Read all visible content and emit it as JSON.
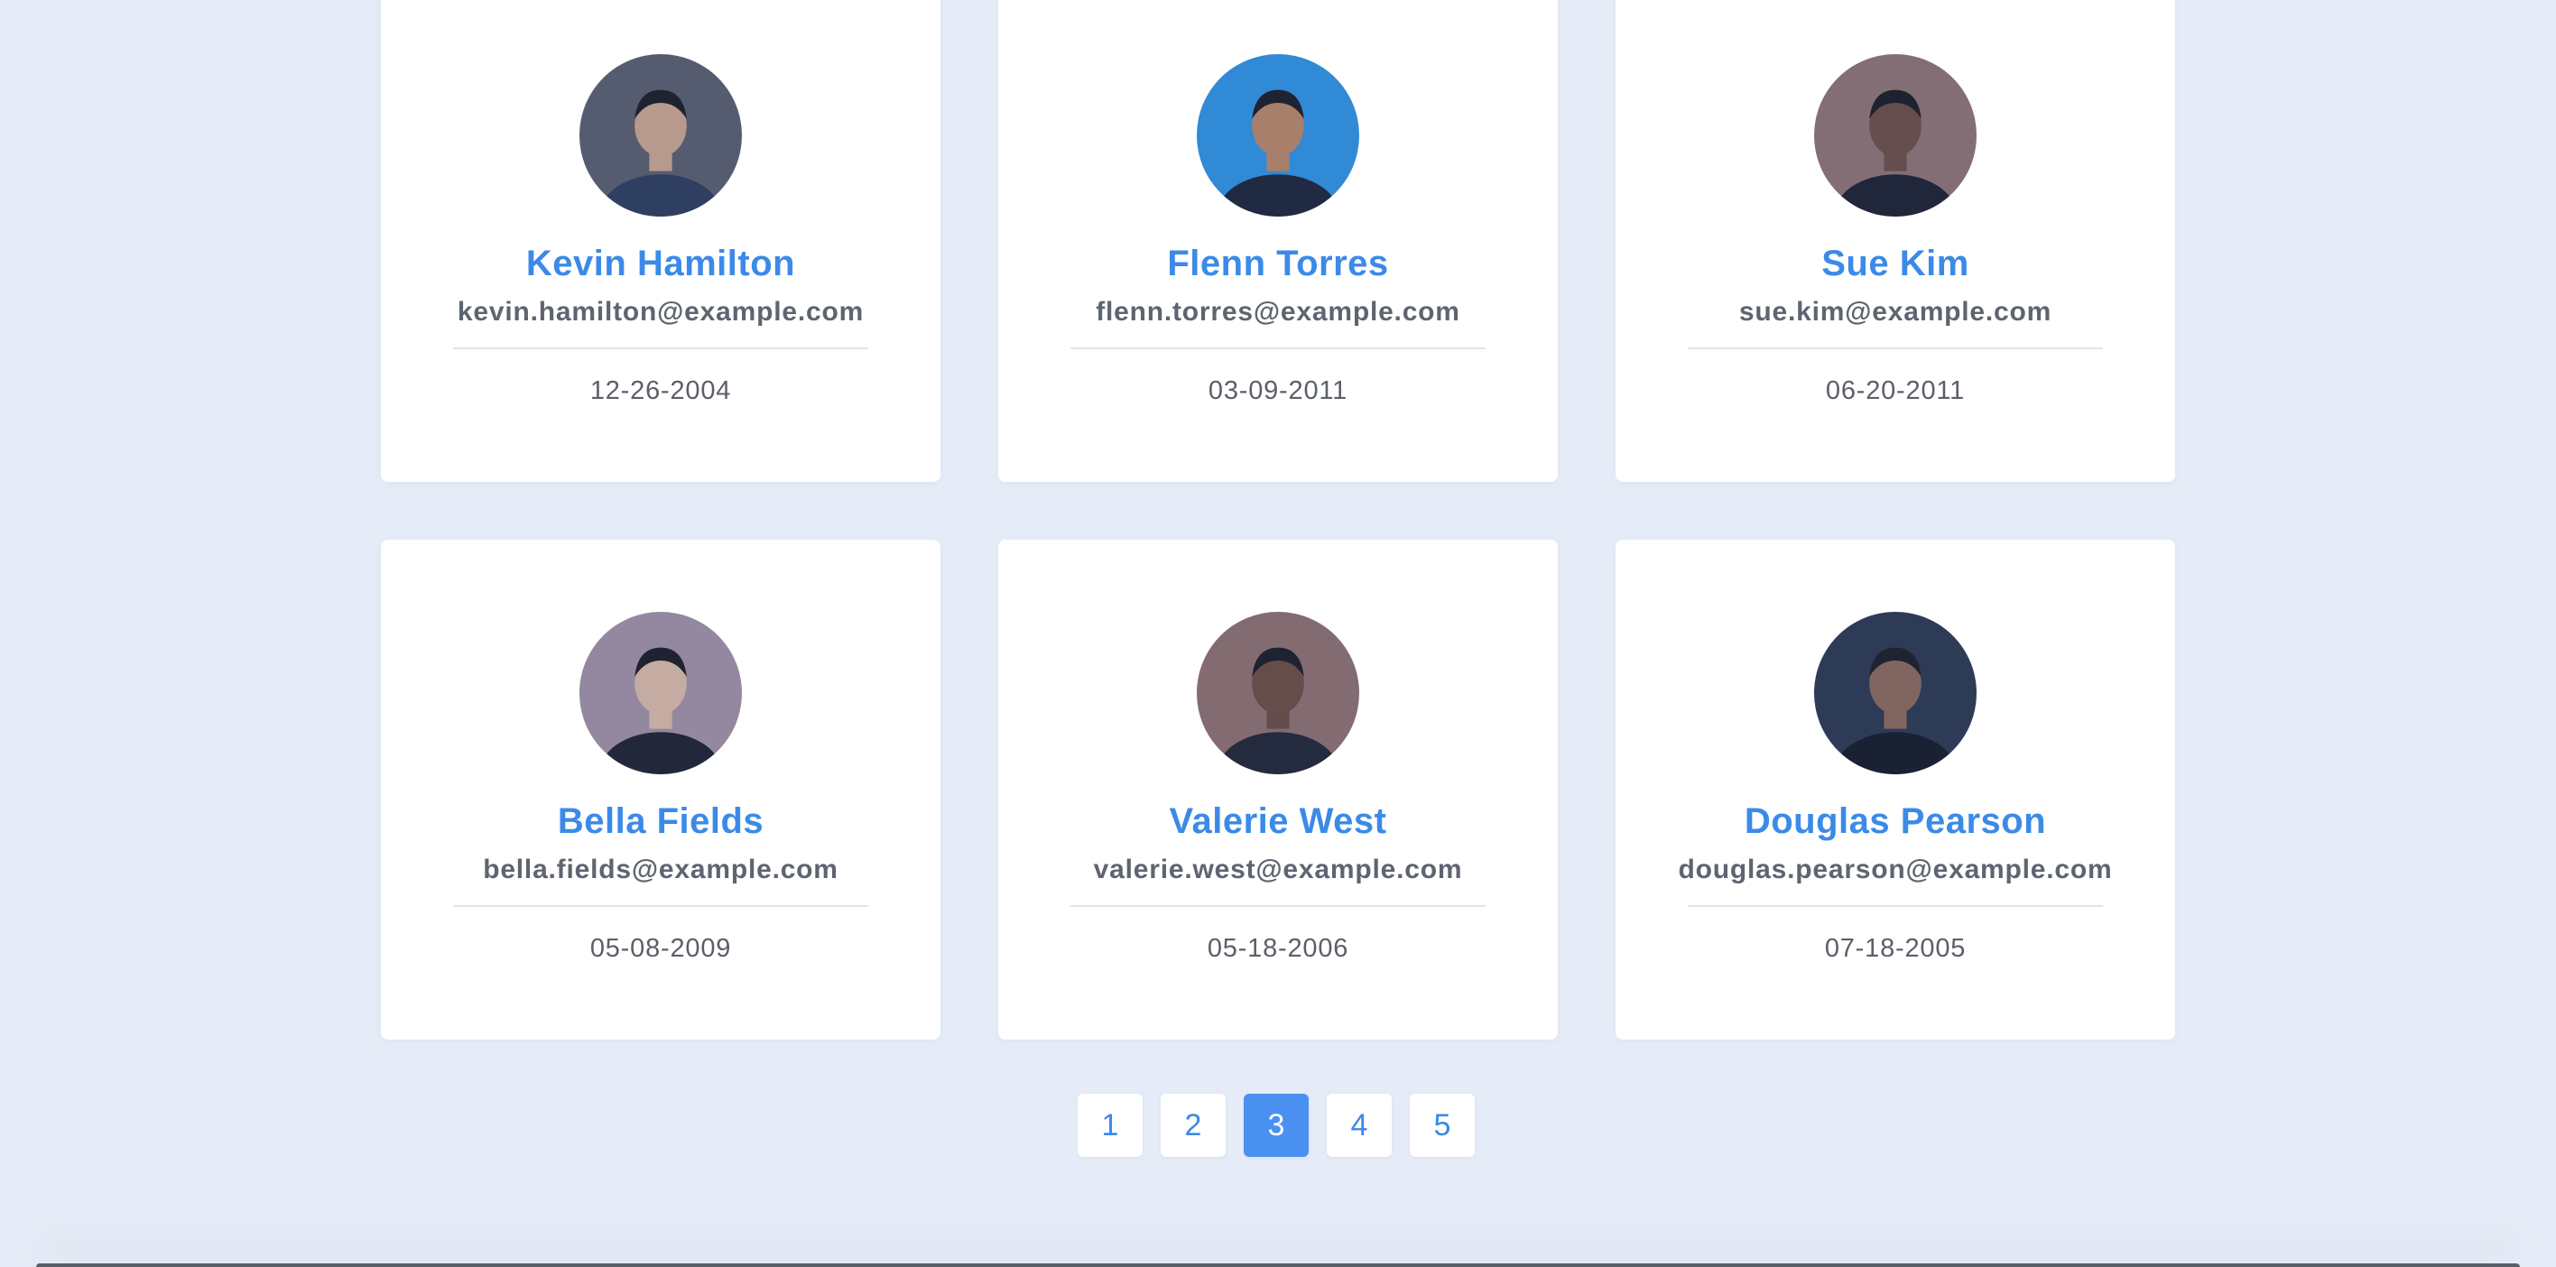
{
  "users": [
    {
      "name": "Kevin Hamilton",
      "email": "kevin.hamilton@example.com",
      "date": "12-26-2004",
      "avatar_colors": [
        "#5b5a62",
        "#2e3a52",
        "#c9a184"
      ]
    },
    {
      "name": "Flenn Torres",
      "email": "flenn.torres@example.com",
      "date": "03-09-2011",
      "avatar_colors": [
        "#2f8fd8",
        "#1d2230",
        "#b7825e"
      ]
    },
    {
      "name": "Sue Kim",
      "email": "sue.kim@example.com",
      "date": "06-20-2011",
      "avatar_colors": [
        "#8f6f6a",
        "#1e1e26",
        "#6b4a3c"
      ]
    },
    {
      "name": "Bella Fields",
      "email": "bella.fields@example.com",
      "date": "05-08-2009",
      "avatar_colors": [
        "#a08c99",
        "#1f1f26",
        "#d9b59d"
      ]
    },
    {
      "name": "Valerie West",
      "email": "valerie.west@example.com",
      "date": "05-18-2006",
      "avatar_colors": [
        "#8e6b66",
        "#22232b",
        "#6a4939"
      ]
    },
    {
      "name": "Douglas Pearson",
      "email": "douglas.pearson@example.com",
      "date": "07-18-2005",
      "avatar_colors": [
        "#2c3547",
        "#15171e",
        "#8a6552"
      ]
    }
  ],
  "pagination": {
    "pages": [
      "1",
      "2",
      "3",
      "4",
      "5"
    ],
    "current": "3"
  },
  "colors": {
    "accent": "#3b8ae8",
    "active_page": "#4a90f0",
    "background": "#e6ecf7"
  }
}
